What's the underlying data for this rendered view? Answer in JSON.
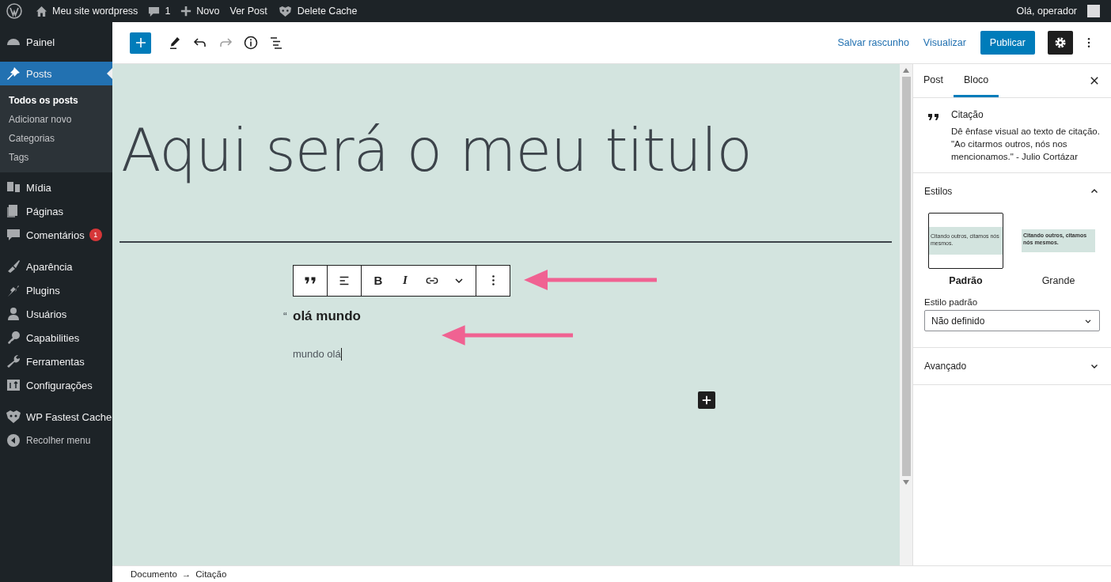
{
  "admin_bar": {
    "items": [
      {
        "kind": "wp-logo"
      },
      {
        "kind": "home",
        "label": "Meu site wordpress"
      },
      {
        "kind": "comments",
        "label": "1"
      },
      {
        "kind": "new",
        "label": "Novo"
      },
      {
        "kind": "link",
        "label": "Ver Post"
      },
      {
        "kind": "cache",
        "label": "Delete Cache"
      }
    ],
    "user": "Olá, operador"
  },
  "sidebar": {
    "groups": [
      [
        {
          "kind": "dashboard",
          "label": "Painel",
          "selected": false
        },
        {
          "kind": "pin",
          "label": "Posts",
          "selected": true,
          "children": [
            {
              "label": "Todos os posts",
              "selected": true
            },
            {
              "label": "Adicionar novo",
              "selected": false
            },
            {
              "label": "Categorias",
              "selected": false
            },
            {
              "label": "Tags",
              "selected": false
            }
          ]
        },
        {
          "kind": "media",
          "label": "Mídia",
          "selected": false
        },
        {
          "kind": "pages",
          "label": "Páginas",
          "selected": false
        },
        {
          "kind": "comments",
          "label": "Comentários",
          "selected": false,
          "badge": "1"
        }
      ],
      [
        {
          "kind": "brush",
          "label": "Aparência",
          "selected": false
        },
        {
          "kind": "plug",
          "label": "Plugins",
          "selected": false
        },
        {
          "kind": "user",
          "label": "Usuários",
          "selected": false
        },
        {
          "kind": "key",
          "label": "Capabilities",
          "selected": false
        },
        {
          "kind": "wrench",
          "label": "Ferramentas",
          "selected": false
        },
        {
          "kind": "settings",
          "label": "Configurações",
          "selected": false
        }
      ],
      [
        {
          "kind": "cache",
          "label": "WP Fastest Cache",
          "selected": false
        },
        {
          "kind": "collapse",
          "label": "Recolher menu",
          "selected": false
        }
      ]
    ]
  },
  "header": {
    "save_draft": "Salvar rascunho",
    "preview": "Visualizar",
    "publish": "Publicar",
    "settings_selected": true
  },
  "editor": {
    "title": "Aqui será o meu titulo",
    "quote_mark": "“",
    "quote_text": "olá mundo",
    "citation": "mundo olá",
    "block_toolbar": [
      [
        {
          "kind": "quote"
        }
      ],
      [
        {
          "kind": "align"
        }
      ],
      [
        {
          "kind": "bold",
          "label": "B"
        },
        {
          "kind": "italic",
          "label": "I"
        },
        {
          "kind": "link"
        },
        {
          "kind": "chevron"
        }
      ],
      [
        {
          "kind": "options"
        }
      ]
    ]
  },
  "settings_panel": {
    "tabs": [
      {
        "label": "Post",
        "selected": false
      },
      {
        "label": "Bloco",
        "selected": true
      }
    ],
    "block": {
      "name": "Citação",
      "description": "Dê ênfase visual ao texto de citação. \"Ao citarmos outros, nós nos mencionamos.\" - Julio Cortázar"
    },
    "styles": {
      "title": "Estilos",
      "expanded": true,
      "options": [
        {
          "label": "Padrão",
          "selected": true,
          "kind": "default",
          "preview": "Citando outros, citamos nós mesmos."
        },
        {
          "label": "Grande",
          "selected": false,
          "kind": "large",
          "preview": "Citando outros, citamos nós mesmos."
        }
      ],
      "default_label": "Estilo padrão",
      "default_value": "Não definido"
    },
    "advanced": {
      "title": "Avançado",
      "expanded": false
    }
  },
  "breadcrumb": {
    "items": [
      "Documento",
      "Citação"
    ],
    "separator": "→"
  }
}
